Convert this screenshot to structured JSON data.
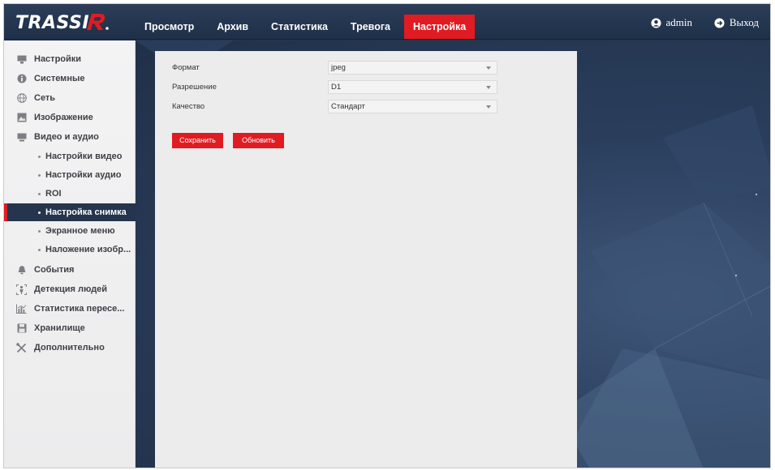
{
  "header": {
    "logo_text": "TRASSIR",
    "nav": [
      {
        "label": "Просмотр",
        "active": false
      },
      {
        "label": "Архив",
        "active": false
      },
      {
        "label": "Статистика",
        "active": false
      },
      {
        "label": "Тревога",
        "active": false
      },
      {
        "label": "Настройка",
        "active": true
      }
    ],
    "user_label": "admin",
    "logout_label": "Выход"
  },
  "sidebar": {
    "items": [
      {
        "label": "Настройки",
        "icon": "monitor-icon"
      },
      {
        "label": "Системные",
        "icon": "info-icon"
      },
      {
        "label": "Сеть",
        "icon": "globe-icon"
      },
      {
        "label": "Изображение",
        "icon": "image-icon"
      },
      {
        "label": "Видео и аудио",
        "icon": "video-icon"
      },
      {
        "label": "Настройки видео",
        "sub": true
      },
      {
        "label": "Настройки аудио",
        "sub": true
      },
      {
        "label": "ROI",
        "sub": true
      },
      {
        "label": "Настройка снимка",
        "sub": true,
        "active": true
      },
      {
        "label": "Экранное меню",
        "sub": true
      },
      {
        "label": "Наложение изобр...",
        "sub": true
      },
      {
        "label": "События",
        "icon": "bell-icon"
      },
      {
        "label": "Детекция людей",
        "icon": "person-detect-icon"
      },
      {
        "label": "Статистика пересе...",
        "icon": "stats-icon"
      },
      {
        "label": "Хранилище",
        "icon": "floppy-icon"
      },
      {
        "label": "Дополнительно",
        "icon": "tools-icon"
      }
    ]
  },
  "form": {
    "format_label": "Формат",
    "format_value": "jpeg",
    "resolution_label": "Разрешение",
    "resolution_value": "D1",
    "quality_label": "Качество",
    "quality_value": "Стандарт",
    "save_label": "Сохранить",
    "refresh_label": "Обновить"
  },
  "colors": {
    "accent": "#e11b22",
    "header_bg": "#24354d",
    "sidebar_bg": "#f0f0f1",
    "panel_bg": "#ececec"
  }
}
